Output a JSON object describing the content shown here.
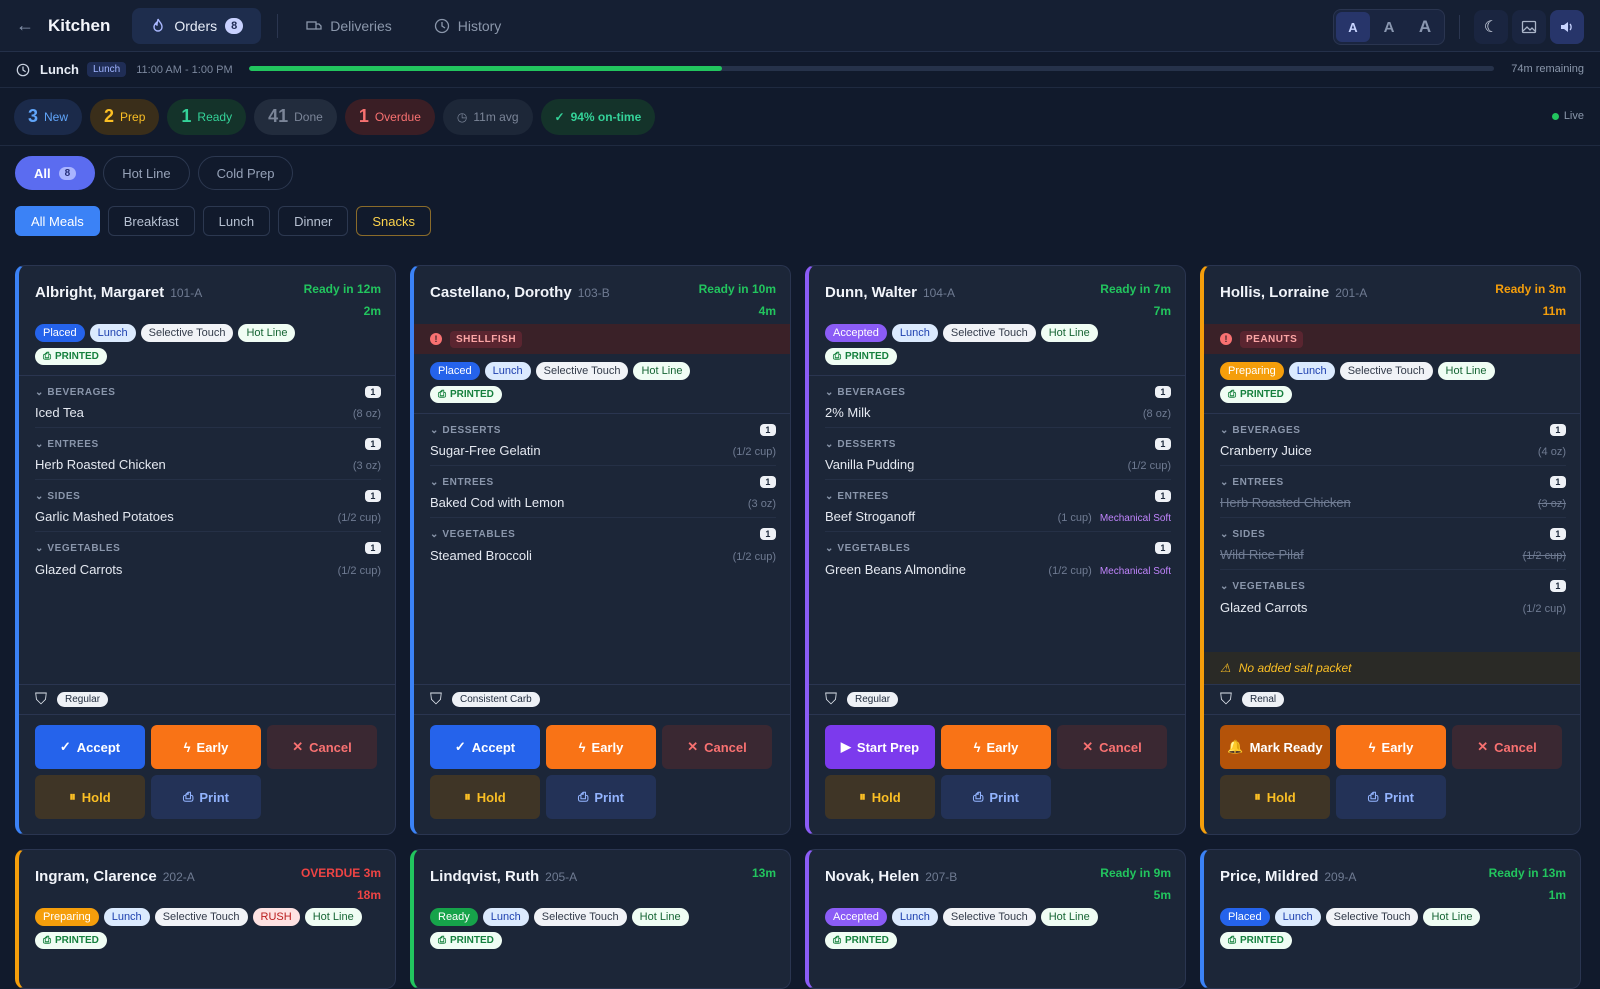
{
  "app": {
    "title": "Kitchen"
  },
  "nav": {
    "orders": "Orders",
    "orders_count": "8",
    "deliveries": "Deliveries",
    "history": "History"
  },
  "font_sizes": [
    "A",
    "A",
    "A"
  ],
  "meal": {
    "name": "Lunch",
    "tag": "Lunch",
    "time": "11:00 AM - 1:00 PM",
    "progress": 0.38,
    "remaining": "74m remaining"
  },
  "stats": {
    "new_n": "3",
    "new_l": "New",
    "prep_n": "2",
    "prep_l": "Prep",
    "ready_n": "1",
    "ready_l": "Ready",
    "done_n": "41",
    "done_l": "Done",
    "over_n": "1",
    "over_l": "Overdue",
    "avg": "11m avg",
    "ontime": "94% on-time",
    "live": "Live"
  },
  "stations": {
    "all": "All",
    "all_count": "8",
    "hot": "Hot Line",
    "cold": "Cold Prep"
  },
  "meals": {
    "all": "All Meals",
    "breakfast": "Breakfast",
    "lunch": "Lunch",
    "dinner": "Dinner",
    "snacks": "Snacks"
  },
  "buttons": {
    "accept": "Accept",
    "early": "Early",
    "cancel": "Cancel",
    "hold": "Hold",
    "print": "Print",
    "start": "Start Prep",
    "mark_ready": "Mark Ready"
  },
  "printed": "PRINTED",
  "orders": [
    {
      "name": "Albright, Margaret",
      "room": "101-A",
      "eta": "Ready in 12m",
      "elapsed": "2m",
      "status": "Placed",
      "meal": "Lunch",
      "texture": "Selective Touch",
      "station": "Hot Line",
      "diet": "Regular",
      "cats": [
        {
          "name": "BEVERAGES",
          "count": "1",
          "items": [
            {
              "name": "Iced Tea",
              "size": "(8 oz)"
            }
          ]
        },
        {
          "name": "ENTREES",
          "count": "1",
          "items": [
            {
              "name": "Herb Roasted Chicken",
              "size": "(3 oz)"
            }
          ]
        },
        {
          "name": "SIDES",
          "count": "1",
          "items": [
            {
              "name": "Garlic Mashed Potatoes",
              "size": "(1/2 cup)"
            }
          ]
        },
        {
          "name": "VEGETABLES",
          "count": "1",
          "items": [
            {
              "name": "Glazed Carrots",
              "size": "(1/2 cup)"
            }
          ]
        }
      ]
    },
    {
      "name": "Castellano, Dorothy",
      "room": "103-B",
      "eta": "Ready in 10m",
      "elapsed": "4m",
      "allergy": "SHELLFISH",
      "status": "Placed",
      "meal": "Lunch",
      "texture": "Selective Touch",
      "station": "Hot Line",
      "diet": "Consistent Carb",
      "cats": [
        {
          "name": "DESSERTS",
          "count": "1",
          "items": [
            {
              "name": "Sugar-Free Gelatin",
              "size": "(1/2 cup)"
            }
          ]
        },
        {
          "name": "ENTREES",
          "count": "1",
          "items": [
            {
              "name": "Baked Cod with Lemon",
              "size": "(3 oz)"
            }
          ]
        },
        {
          "name": "VEGETABLES",
          "count": "1",
          "items": [
            {
              "name": "Steamed Broccoli",
              "size": "(1/2 cup)"
            }
          ]
        }
      ]
    },
    {
      "name": "Dunn, Walter",
      "room": "104-A",
      "eta": "Ready in 7m",
      "elapsed": "7m",
      "status": "Accepted",
      "meal": "Lunch",
      "texture": "Selective Touch",
      "station": "Hot Line",
      "diet": "Regular",
      "cats": [
        {
          "name": "BEVERAGES",
          "count": "1",
          "items": [
            {
              "name": "2% Milk",
              "size": "(8 oz)"
            }
          ]
        },
        {
          "name": "DESSERTS",
          "count": "1",
          "items": [
            {
              "name": "Vanilla Pudding",
              "size": "(1/2 cup)"
            }
          ]
        },
        {
          "name": "ENTREES",
          "count": "1",
          "items": [
            {
              "name": "Beef Stroganoff",
              "size": "(1 cup)",
              "mod": "Mechanical Soft"
            }
          ]
        },
        {
          "name": "VEGETABLES",
          "count": "1",
          "items": [
            {
              "name": "Green Beans Almondine",
              "size": "(1/2 cup)",
              "mod": "Mechanical Soft"
            }
          ]
        }
      ]
    },
    {
      "name": "Hollis, Lorraine",
      "room": "201-A",
      "eta": "Ready in 3m",
      "elapsed": "11m",
      "allergy": "PEANUTS",
      "status": "Preparing",
      "meal": "Lunch",
      "texture": "Selective Touch",
      "station": "Hot Line",
      "diet": "Renal",
      "note": "No added salt packet",
      "cats": [
        {
          "name": "BEVERAGES",
          "count": "1",
          "items": [
            {
              "name": "Cranberry Juice",
              "size": "(4 oz)"
            }
          ]
        },
        {
          "name": "ENTREES",
          "count": "1",
          "items": [
            {
              "name": "Herb Roasted Chicken",
              "size": "(3 oz)"
            }
          ]
        },
        {
          "name": "SIDES",
          "count": "1",
          "items": [
            {
              "name": "Wild Rice Pilaf",
              "size": "(1/2 cup)"
            }
          ]
        },
        {
          "name": "VEGETABLES",
          "count": "1",
          "items": [
            {
              "name": "Glazed Carrots",
              "size": "(1/2 cup)"
            }
          ]
        }
      ]
    },
    {
      "name": "Ingram, Clarence",
      "room": "202-A",
      "eta": "OVERDUE 3m",
      "elapsed": "18m",
      "status": "Preparing",
      "meal": "Lunch",
      "texture": "Selective Touch",
      "rush": "RUSH",
      "station": "Hot Line"
    },
    {
      "name": "Lindqvist, Ruth",
      "room": "205-A",
      "elapsed": "13m",
      "status": "Ready",
      "meal": "Lunch",
      "texture": "Selective Touch",
      "station": "Hot Line"
    },
    {
      "name": "Novak, Helen",
      "room": "207-B",
      "eta": "Ready in 9m",
      "elapsed": "5m",
      "status": "Accepted",
      "meal": "Lunch",
      "texture": "Selective Touch",
      "station": "Hot Line"
    },
    {
      "name": "Price, Mildred",
      "room": "209-A",
      "eta": "Ready in 13m",
      "elapsed": "1m",
      "status": "Placed",
      "meal": "Lunch",
      "texture": "Selective Touch",
      "station": "Hot Line"
    }
  ],
  "colors": {
    "placed": "#3b82f6",
    "accepted": "#8b5cf6",
    "preparing": "#f59e0b",
    "ready": "#22c55e",
    "eta_ok": "#22c55e",
    "eta_warn": "#f59e0b",
    "overdue": "#ef4444"
  }
}
